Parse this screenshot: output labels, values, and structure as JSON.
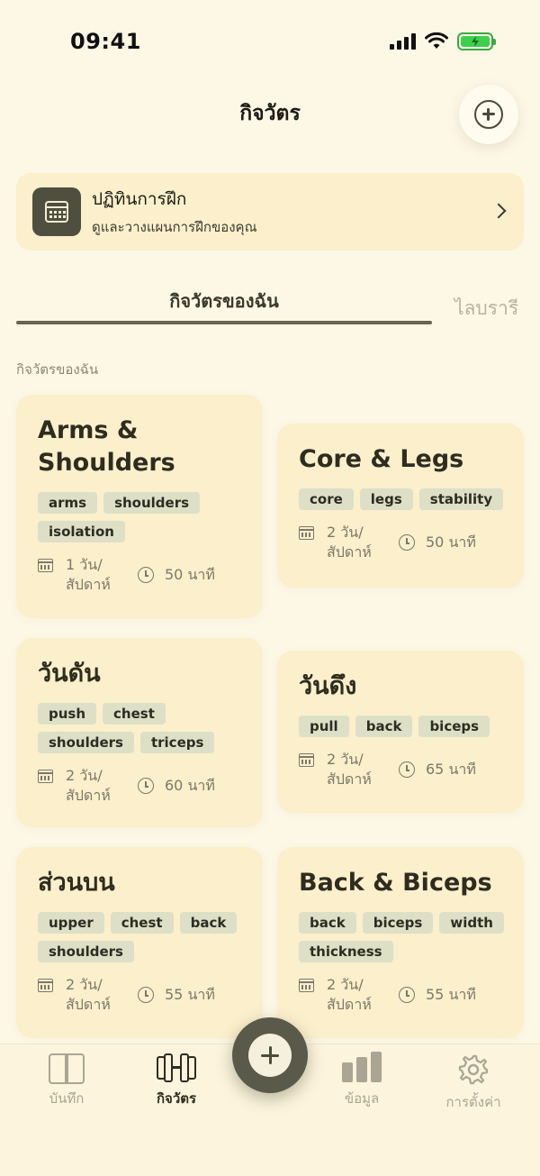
{
  "status_bar": {
    "time": "09:41"
  },
  "header": {
    "title": "กิจวัตร"
  },
  "calendar_banner": {
    "title": "ปฏิทินการฝึก",
    "subtitle": "ดูและวางแผนการฝึกของคุณ"
  },
  "tabs": [
    {
      "label": "กิจวัตรของฉัน",
      "active": true
    },
    {
      "label": "ไลบรารี",
      "active": false
    }
  ],
  "section_label": "กิจวัตรของฉัน",
  "routines": [
    {
      "title": "Arms & Shoulders",
      "tags": [
        "arms",
        "shoulders",
        "isolation"
      ],
      "days": "1 วัน/ สัปดาห์",
      "duration": "50 นาที"
    },
    {
      "title": "Core & Legs",
      "tags": [
        "core",
        "legs",
        "stability"
      ],
      "days": "2 วัน/ สัปดาห์",
      "duration": "50 นาที"
    },
    {
      "title": "วันดัน",
      "tags": [
        "push",
        "chest",
        "shoulders",
        "triceps"
      ],
      "days": "2 วัน/ สัปดาห์",
      "duration": "60 นาที"
    },
    {
      "title": "วันดึง",
      "tags": [
        "pull",
        "back",
        "biceps"
      ],
      "days": "2 วัน/ สัปดาห์",
      "duration": "65 นาที"
    },
    {
      "title": "ส่วนบน",
      "tags": [
        "upper",
        "chest",
        "back",
        "shoulders"
      ],
      "days": "2 วัน/ สัปดาห์",
      "duration": "55 นาที"
    },
    {
      "title": "Back & Biceps",
      "tags": [
        "back",
        "biceps",
        "width",
        "thickness"
      ],
      "days": "2 วัน/ สัปดาห์",
      "duration": "55 นาที"
    }
  ],
  "bottom_nav": [
    {
      "label": "บันทึก",
      "icon": "book-icon"
    },
    {
      "label": "กิจวัตร",
      "icon": "dumbbell-icon",
      "active": true
    },
    {
      "label": "ข้อมูล",
      "icon": "bar-chart-icon"
    },
    {
      "label": "การตั้งค่า",
      "icon": "gear-icon"
    }
  ],
  "colors": {
    "background": "#fdf7e6",
    "card": "#fbefcc",
    "accent": "#5a5a4a",
    "tag": "#dde0c6",
    "battery": "#3ecf4c"
  }
}
